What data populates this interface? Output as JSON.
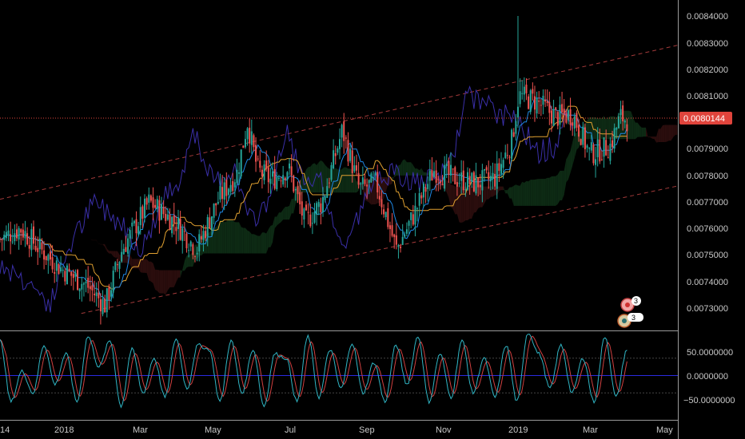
{
  "colors": {
    "background": "#000000",
    "bull": "#26a69a",
    "bear": "#ef5350",
    "tenkan": "#1e88e5",
    "kijun": "#e0a030",
    "lagging": "#3a2fa8",
    "cloud_bull": "#0d2a14",
    "cloud_bear": "#2a0d0d",
    "channel": "#a33a3a",
    "price_line": "#e0443c",
    "stoch_k": "#2fb5c4",
    "stoch_d": "#d04040",
    "zero_line": "#2a2ae0",
    "axis_text": "#c9c9c9",
    "separator": "#9a9a9a"
  },
  "price_axis": {
    "labels": [
      "0.0084000",
      "0.0083000",
      "0.0082000",
      "0.0081000",
      "0.0079000",
      "0.0078000",
      "0.0077000",
      "0.0076000",
      "0.0075000",
      "0.0074000",
      "0.0073000"
    ],
    "current_price_label": "0.0080144"
  },
  "oscillator_axis": {
    "labels": [
      "50.0000000",
      "0.0000000",
      "−50.0000000"
    ]
  },
  "time_axis": {
    "labels": [
      "14",
      "2018",
      "Mar",
      "May",
      "Jul",
      "Sep",
      "Nov",
      "2019",
      "Mar",
      "May"
    ]
  },
  "badges": [
    "3",
    "3"
  ],
  "chart_data": [
    {
      "type": "candlestick",
      "subtype": "ichimoku",
      "ylim": [
        0.00722,
        0.00841
      ],
      "current_price": 0.0080144,
      "price_path": [
        {
          "t": 0,
          "v": 0.00756
        },
        {
          "t": 0.03,
          "v": 0.0076
        },
        {
          "t": 0.06,
          "v": 0.00752
        },
        {
          "t": 0.09,
          "v": 0.00745
        },
        {
          "t": 0.13,
          "v": 0.00738
        },
        {
          "t": 0.155,
          "v": 0.00731
        },
        {
          "t": 0.18,
          "v": 0.00752
        },
        {
          "t": 0.22,
          "v": 0.0077
        },
        {
          "t": 0.26,
          "v": 0.00762
        },
        {
          "t": 0.29,
          "v": 0.00752
        },
        {
          "t": 0.32,
          "v": 0.0077
        },
        {
          "t": 0.35,
          "v": 0.00781
        },
        {
          "t": 0.365,
          "v": 0.008
        },
        {
          "t": 0.38,
          "v": 0.00782
        },
        {
          "t": 0.4,
          "v": 0.00778
        },
        {
          "t": 0.425,
          "v": 0.00783
        },
        {
          "t": 0.45,
          "v": 0.00762
        },
        {
          "t": 0.475,
          "v": 0.0077
        },
        {
          "t": 0.505,
          "v": 0.00797
        },
        {
          "t": 0.53,
          "v": 0.00775
        },
        {
          "t": 0.555,
          "v": 0.00777
        },
        {
          "t": 0.585,
          "v": 0.00752
        },
        {
          "t": 0.61,
          "v": 0.00765
        },
        {
          "t": 0.64,
          "v": 0.00782
        },
        {
          "t": 0.67,
          "v": 0.00779
        },
        {
          "t": 0.7,
          "v": 0.00777
        },
        {
          "t": 0.73,
          "v": 0.00779
        },
        {
          "t": 0.755,
          "v": 0.00793
        },
        {
          "t": 0.765,
          "v": 0.0081
        },
        {
          "t": 0.79,
          "v": 0.00808
        },
        {
          "t": 0.82,
          "v": 0.00802
        },
        {
          "t": 0.845,
          "v": 0.00803
        },
        {
          "t": 0.87,
          "v": 0.00788
        },
        {
          "t": 0.9,
          "v": 0.00791
        },
        {
          "t": 0.915,
          "v": 0.00802
        },
        {
          "t": 0.925,
          "v": 0.00801
        }
      ],
      "spike": {
        "t": 0.764,
        "high": 0.0084
      },
      "channel": {
        "upper": [
          {
            "t": 0,
            "v": 0.00771
          },
          {
            "t": 1,
            "v": 0.00829
          }
        ],
        "lower": [
          {
            "t": 0.12,
            "v": 0.00728
          },
          {
            "t": 1,
            "v": 0.00776
          }
        ]
      }
    },
    {
      "type": "line",
      "subtype": "stochastic",
      "ylim": [
        -100,
        100
      ],
      "levels": [
        40,
        0,
        -40
      ],
      "k_path": [
        80,
        -60,
        10,
        -40,
        70,
        -20,
        50,
        -60,
        90,
        20,
        80,
        -70,
        60,
        -40,
        40,
        -50,
        85,
        -30,
        70,
        60,
        -60,
        80,
        -40,
        60,
        -70,
        50,
        40,
        -60,
        90,
        -50,
        60,
        -30,
        75,
        -40,
        30,
        -60,
        70,
        -20,
        90,
        -60,
        50,
        -50,
        80,
        -40,
        40,
        -50,
        70,
        -60,
        100,
        50,
        -30,
        70,
        -40,
        40,
        -60,
        90,
        -50,
        60
      ]
    }
  ]
}
